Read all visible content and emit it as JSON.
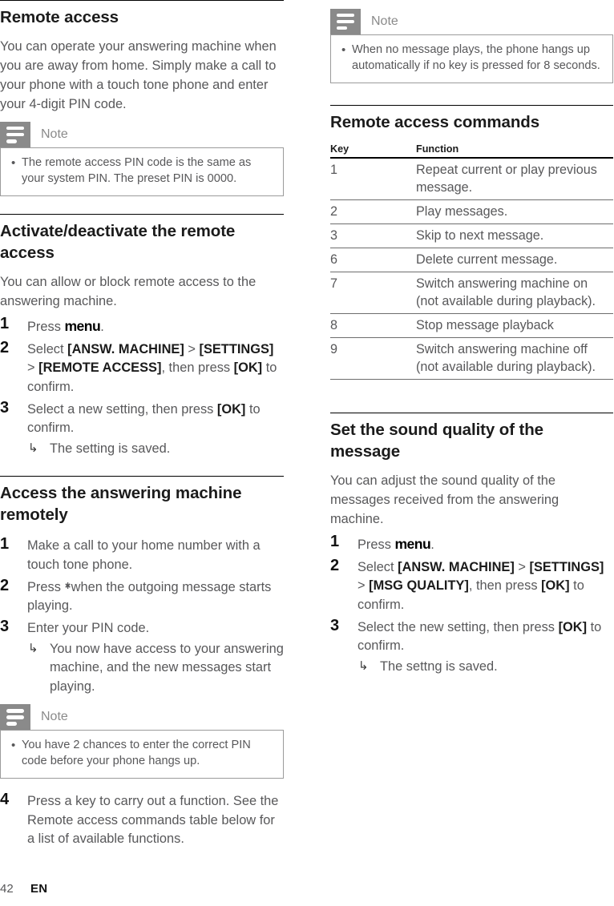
{
  "footer": {
    "page_number": "42",
    "language": "EN"
  },
  "note_icon_name": "note-lines-icon",
  "left_column": {
    "section1": {
      "heading": "Remote access",
      "paragraph": "You can operate your answering machine when you are away from home. Simply make a call to your phone with a touch tone phone and enter your 4-digit PIN code.",
      "note": {
        "title": "Note",
        "bullet": "•",
        "text": "The remote access PIN code is the same as your system PIN. The preset PIN is 0000."
      }
    },
    "section2": {
      "heading": "Activate/deactivate the remote access",
      "paragraph": "You can allow or block remote access to the answering machine.",
      "steps": [
        {
          "num": "1",
          "prefix": "Press ",
          "key": "menu",
          "suffix": "."
        },
        {
          "num": "2",
          "line1_prefix": "Select ",
          "menu1": "[ANSW. MACHINE]",
          "sep1": " > ",
          "menu2": "[SETTINGS]",
          "sep2": " > ",
          "menu3": "[REMOTE ACCESS]",
          "mid": ", then press ",
          "ok": "[OK]",
          "tail": " to confirm."
        },
        {
          "num": "3",
          "prefix": "Select a new setting, then press ",
          "ok": "[OK]",
          "tail": " to confirm.",
          "result_arrow": "↳",
          "result": "The setting is saved."
        }
      ]
    },
    "section3": {
      "heading": "Access the answering machine remotely",
      "steps": [
        {
          "num": "1",
          "text": "Make a call to your home number with a touch tone phone."
        },
        {
          "num": "2",
          "prefix": "Press ",
          "star": "✱",
          "tail": "when the outgoing message starts playing."
        },
        {
          "num": "3",
          "text": "Enter your PIN code.",
          "result_arrow": "↳",
          "result": "You now have access to your answering machine, and the new messages start playing."
        }
      ],
      "note": {
        "title": "Note",
        "bullet": "•",
        "text": "You have 2 chances to enter the correct PIN code before your phone hangs up."
      },
      "step4": {
        "num": "4",
        "text": "Press a key to carry out a function. See the Remote access commands table below for a list of available functions."
      }
    }
  },
  "right_column": {
    "note": {
      "title": "Note",
      "bullet": "•",
      "text": "When no message plays, the phone hangs up automatically if no key is pressed for 8 seconds."
    },
    "section_commands": {
      "heading": "Remote access commands",
      "table": {
        "columns": [
          "Key",
          "Function"
        ],
        "rows": [
          [
            "1",
            "Repeat current or play previous message."
          ],
          [
            "2",
            "Play messages."
          ],
          [
            "3",
            "Skip to next message."
          ],
          [
            "6",
            "Delete current message."
          ],
          [
            "7",
            "Switch answering machine on (not available during playback)."
          ],
          [
            "8",
            "Stop message playback"
          ],
          [
            "9",
            "Switch answering machine off (not available during playback)."
          ]
        ]
      }
    },
    "section_sound": {
      "heading": "Set the sound quality of the message",
      "paragraph": "You can adjust the sound quality of the messages received from the answering machine.",
      "steps": [
        {
          "num": "1",
          "prefix": "Press ",
          "key": "menu",
          "suffix": "."
        },
        {
          "num": "2",
          "line1_prefix": "Select ",
          "menu1": "[ANSW. MACHINE]",
          "sep1": " > ",
          "menu2": "[SETTINGS]",
          "sep2": " > ",
          "menu3": "[MSG QUALITY]",
          "mid": ", then press ",
          "ok": "[OK]",
          "tail": " to confirm."
        },
        {
          "num": "3",
          "prefix": "Select the new setting, then press ",
          "ok": "[OK]",
          "tail": " to confirm.",
          "result_arrow": "↳",
          "result": "The settng is saved."
        }
      ]
    }
  }
}
